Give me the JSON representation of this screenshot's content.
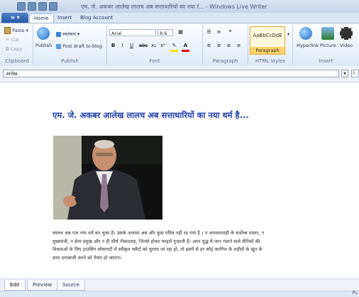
{
  "window": {
    "title": "एम. जे. अकबर आलेख लालच अब सत्ताधारियों का नया f... - Windows Live Writer",
    "app_menu": "≡ ▾"
  },
  "tabs": [
    "Home",
    "Insert",
    "Blog Account"
  ],
  "ribbon": {
    "clipboard": {
      "paste": "Paste",
      "cut": "Cut",
      "copy": "Copy",
      "label": "Clipboard"
    },
    "publish": {
      "publish": "Publish",
      "account": "स्वतंत्रता",
      "draft": "Post draft to blog",
      "label": "Publish"
    },
    "font": {
      "family": "Arial",
      "size": "8.6",
      "bold": "B",
      "italic": "I",
      "underline": "U",
      "strike": "abc",
      "sub": "x₂",
      "sup": "x²",
      "label": "Font"
    },
    "paragraph": {
      "label": "Paragraph"
    },
    "styles": {
      "sample": "AaBbCcDdE",
      "selected": "Paragraph",
      "label": "HTML styles"
    },
    "insert": {
      "hyperlink": "Hyperlink",
      "picture": "Picture",
      "video": "Video",
      "label": "Insert"
    }
  },
  "post": {
    "title_field": "आलेख",
    "heading": "एम. जे. अकबर आलेख लालच अब सत्ताधारियों का नया धर्म है...",
    "body": "लालच अब एक नया धर्म बन चुका है। उसके अलावा अब और कुछ पवित्र नहीं रह गया है । न अफसरशाही के सर्वोच्च दफ्तर, न मुख्यमंत्री, न सेना प्रमुख और न ही शीर्ष नौकरशाह, जिनसे होकर फाइलें गुजरती हैं। अगर युद्ध में जान गंवाने वाले सैनिकों की विधवाओं के लिए हाउसिंग सोसायटी में स्वीकृत फ्लैटों को चुराया जा रहा हो, तो इसमें से हर कोई करगिल के शहीदों के खून के साथ दगाबाजी करने को तैयार हो जाएगा।"
  },
  "bottom_tabs": [
    "Edit",
    "Preview",
    "Source"
  ],
  "status": "Pu"
}
